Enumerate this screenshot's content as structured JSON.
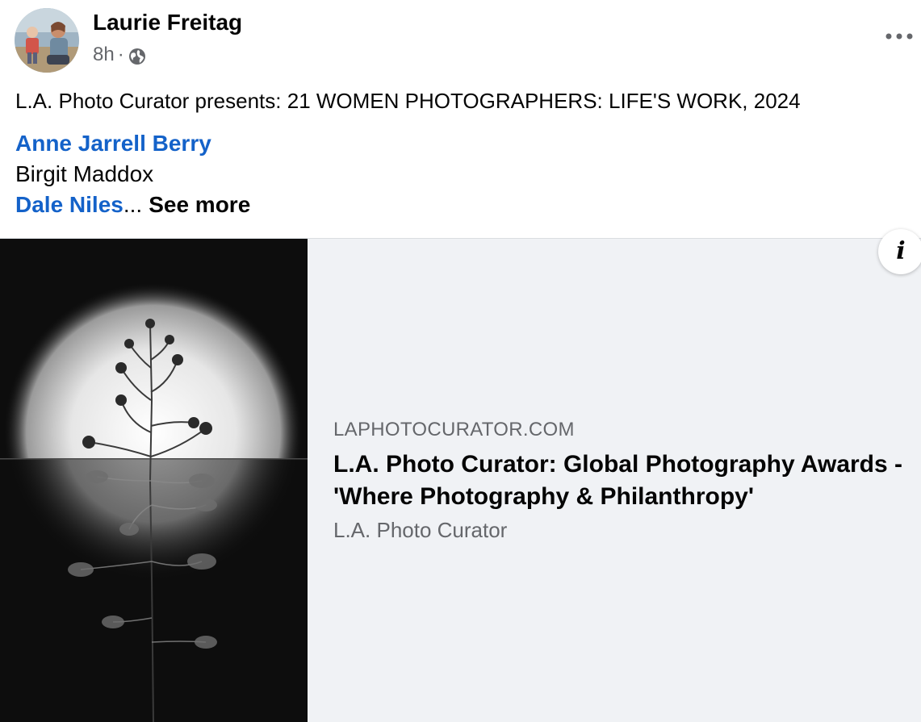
{
  "post": {
    "author": "Laurie Freitag",
    "time": "8h",
    "separator": "·",
    "audience_icon": "globe-icon",
    "caption": "L.A. Photo Curator presents: 21 WOMEN PHOTOGRAPHERS: LIFE'S WORK, 2024",
    "names": [
      {
        "text": "Anne Jarrell Berry",
        "linked": true
      },
      {
        "text": "Birgit Maddox",
        "linked": false
      },
      {
        "text": "Dale Niles",
        "linked": true
      }
    ],
    "ellipsis": "...",
    "see_more": "See more"
  },
  "link_preview": {
    "domain": "LAPHOTOCURATOR.COM",
    "title": "L.A. Photo Curator: Global Photography Awards - 'Where Photography & Philanthropy'",
    "source": "L.A. Photo Curator",
    "info_icon": "info-icon"
  },
  "colors": {
    "link": "#1462c9",
    "text": "#050505",
    "secondary": "#65676b",
    "preview_bg": "#f0f2f5"
  }
}
